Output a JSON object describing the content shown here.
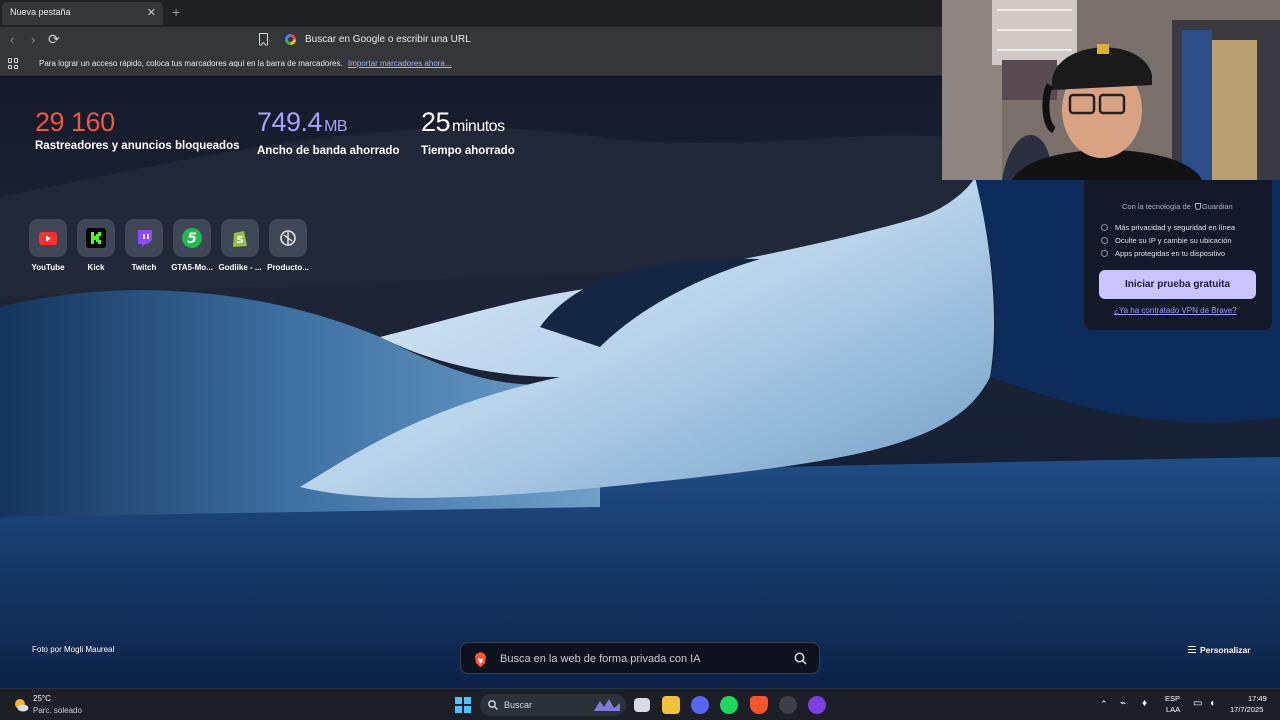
{
  "browser": {
    "tab_title": "Nueva pestaña",
    "address_placeholder": "Buscar en Google o escribir una URL",
    "bookmarks_message": "Para lograr un acceso rápido, coloca tus marcadores aquí en la barra de marcadores.",
    "bookmarks_import_link": "Importar marcadores ahora..."
  },
  "stats": {
    "trackers": {
      "value": "29 160",
      "unit": "",
      "label": "Rastreadores y anuncios bloqueados",
      "color": "#f0553f"
    },
    "bandwidth": {
      "value": "749.4",
      "unit": "MB",
      "label": "Ancho de banda ahorrado",
      "color": "#a8a2ff"
    },
    "time": {
      "value": "25",
      "unit": "minutos",
      "label": "Tiempo ahorrado",
      "color": "#ffffff"
    }
  },
  "shortcuts": [
    {
      "label": "YouTube",
      "icon": "youtube-icon"
    },
    {
      "label": "Kick",
      "icon": "kick-icon"
    },
    {
      "label": "Twitch",
      "icon": "twitch-icon"
    },
    {
      "label": "GTA5-Mo...",
      "icon": "gta5-mods-icon"
    },
    {
      "label": "Godlike - ...",
      "icon": "shopify-icon"
    },
    {
      "label": "Producto...",
      "icon": "product-icon"
    }
  ],
  "vpn": {
    "powered_by": "Con la tecnología de",
    "partner": "Guardian",
    "features": [
      "Más privacidad y seguridad en línea",
      "Oculte su IP y cambie su ubicación",
      "Apps protegidas en tu dispositivo"
    ],
    "cta": "Iniciar prueba gratuita",
    "link": "¿Ya ha contratado VPN de Brave?"
  },
  "photo_credit": "Foto por Mogli Maureal",
  "ai_search_placeholder": "Busca en la web de forma privada con IA",
  "customize": "Personalizar",
  "taskbar": {
    "temperature": "25°C",
    "weather": "Parc. soleado",
    "search": "Buscar",
    "language": "ESP",
    "layout": "LAA",
    "time": "17:49",
    "date": "17/7/2025"
  }
}
